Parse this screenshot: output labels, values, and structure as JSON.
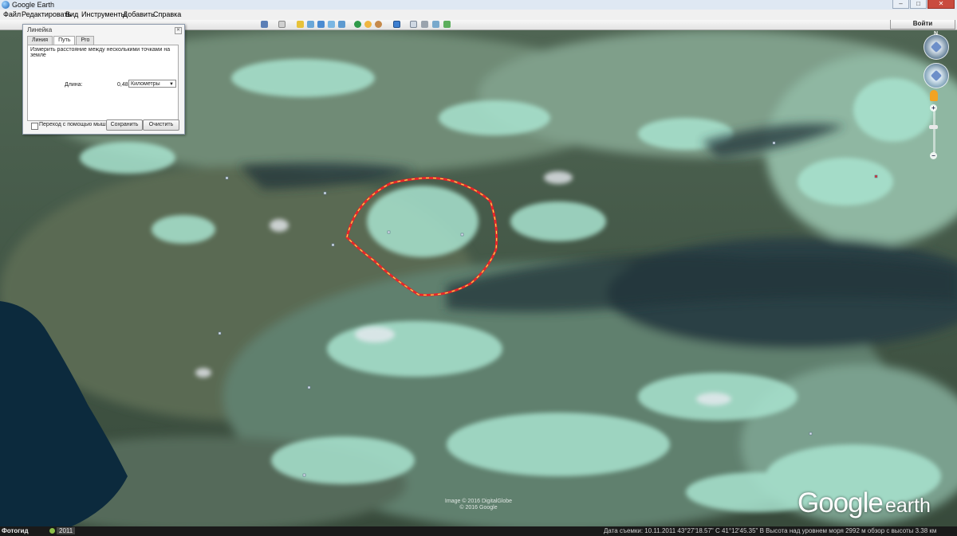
{
  "window": {
    "title": "Google Earth",
    "minimize": "–",
    "maximize": "□",
    "close": "✕"
  },
  "menu": {
    "items": [
      "Файл",
      "Редактировать",
      "Вид",
      "Инструменты",
      "Добавить",
      "Справка"
    ]
  },
  "toolbar": {
    "signin_label": "Войти",
    "icons": [
      "search-icon",
      "sidebar-icon",
      "placemark-icon",
      "polygon-icon",
      "path-icon",
      "overlay-icon",
      "tour-icon",
      "historical-imagery-icon",
      "sunlight-icon",
      "planets-icon",
      "ruler-icon",
      "email-icon",
      "print-icon",
      "save-image-icon",
      "maps-icon"
    ]
  },
  "ruler": {
    "title": "Линейка",
    "close": "✕",
    "tabs": [
      {
        "label": "Линия",
        "active": false
      },
      {
        "label": "Путь",
        "active": true
      },
      {
        "label": "Pro",
        "active": false
      }
    ],
    "description": "Измерить расстояние между несколькими точками на земле",
    "length_label": "Длина:",
    "length_value": "0,48",
    "units": "Километры",
    "mouse_nav_label": "Переход с помощью мыши",
    "mouse_nav_checked": false,
    "save_label": "Сохранить",
    "clear_label": "Очистить"
  },
  "nav": {
    "compass_letter": "N",
    "zoom_in": "+",
    "zoom_out": "−",
    "zoom_level": 0.6
  },
  "map": {
    "attribution_line1": "Image © 2016 DigitalGlobe",
    "attribution_line2": "© 2016 Google",
    "logo_google": "Google",
    "logo_earth": "earth",
    "path_color": "#e8262b",
    "path_dash_color": "#f2e24a"
  },
  "status": {
    "photos_label": "Фотогид",
    "year": "2011",
    "text": "Дата съемки: 10.11.2011   43°27'18.57\" С   41°12'45.35\" В   Высота над уровнем моря  2992 м     обзор с высоты  3.38 км"
  }
}
